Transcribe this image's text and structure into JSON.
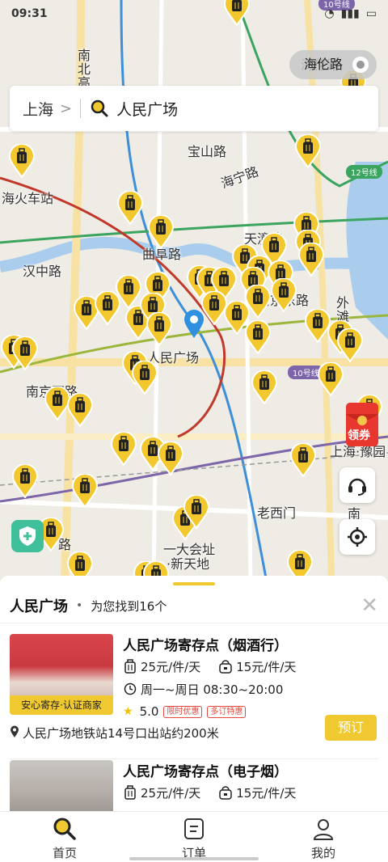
{
  "status_bar": {
    "time": "09:31"
  },
  "map": {
    "labels": {
      "hailun_road": "海伦路",
      "nanbeigao": "南北高",
      "baoshan_road": "宝山路",
      "haining_road": "海宁路",
      "train_station": "海火车站",
      "line12": "12号线",
      "line10_top": "10号线",
      "line10": "10号线",
      "tiantong_road": "天潼路",
      "qufu_road": "曲阜路",
      "hanzhong_road": "汉中路",
      "nanjing_east": "南京东路",
      "waitan": "外滩",
      "renmin_square": "人民广场",
      "nanjing_west": "南京西路",
      "yuyuan": "上海·豫园",
      "laoximen": "老西门",
      "yidahuizhi": "一大会址",
      "xintiandi": "·新天地",
      "south_road": "南",
      "bottom_road": "路"
    }
  },
  "search": {
    "city": "上海",
    "chevron": ">",
    "query": "人民广场"
  },
  "coupon": {
    "label": "领券"
  },
  "sheet": {
    "title": "人民广场",
    "dot": "•",
    "count": "为您找到16个",
    "close": "✕"
  },
  "cards": [
    {
      "name": "人民广场寄存点（烟酒行）",
      "price_large": "25元/件/天",
      "price_small": "15元/件/天",
      "hours": "周一~周日 08:30~20:00",
      "rating": "5.0",
      "badges": [
        "限时优惠",
        "多订特惠"
      ],
      "tag": "安心寄存·认证商家",
      "address": "人民广场地铁站14号口出站约200米",
      "book": "预订"
    },
    {
      "name": "人民广场寄存点（电子烟）",
      "price_large": "25元/件/天",
      "price_small": "15元/件/天"
    }
  ],
  "tabs": [
    {
      "label": "首页",
      "icon": "search-icon",
      "active": true
    },
    {
      "label": "订单",
      "icon": "order-icon",
      "active": false
    },
    {
      "label": "我的",
      "icon": "person-icon",
      "active": false
    }
  ],
  "colors": {
    "accent": "#f0c930",
    "water": "#aacdee",
    "map_bg": "#efece6"
  }
}
